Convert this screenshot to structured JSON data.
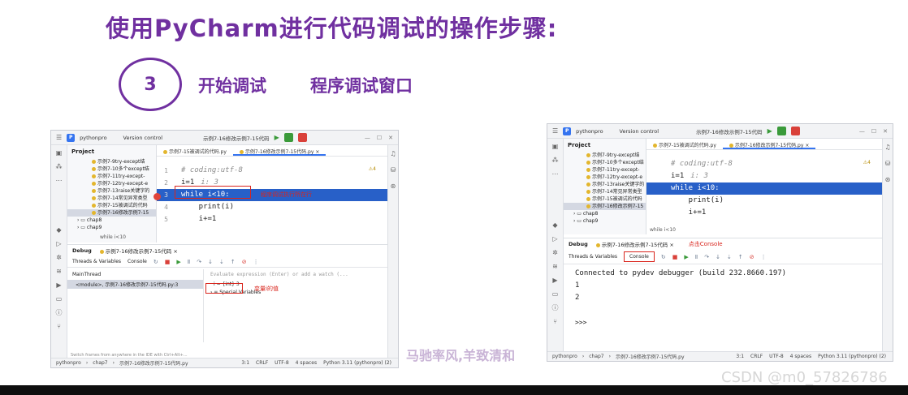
{
  "slide": {
    "title": "使用PyCharm进行代码调试的操作步骤:",
    "step_number": "3",
    "step_label": "开始调试",
    "step_label2": "程序调试窗口",
    "watermark": "马驰率风,羊致清和",
    "csdn": "CSDN @m0_57826786"
  },
  "left_ide": {
    "project_name": "pythonpro",
    "project_badge": "P",
    "version_control": "Version control",
    "run_config": "示例7-16修改示例7-15代码",
    "project_label": "Project",
    "tree": [
      "示例7-9try-except结",
      "示例7-10多个except结",
      "示例7-11try-except-",
      "示例7-12try-except-e",
      "示例7-13raise关键字的",
      "示例7-14常见异常类型",
      "示例7-15被调试的代码",
      "示例7-16修改示例7-15"
    ],
    "folders": [
      "chap8",
      "chap9"
    ],
    "tabs": [
      "示例7-15被调试的代码.py",
      "示例7-16修改示例7-15代码.py"
    ],
    "code": [
      {
        "n": "1",
        "text": "# coding:utf-8",
        "val": ""
      },
      {
        "n": "2",
        "text": "i=1",
        "val": "i: 3"
      },
      {
        "n": "3",
        "text": "while i<10:",
        "val": ""
      },
      {
        "n": "4",
        "text": "    print(i)",
        "val": ""
      },
      {
        "n": "5",
        "text": "    i+=1",
        "val": ""
      }
    ],
    "warn": "⚠4",
    "breadcrumb": "while i<10",
    "annotation_code": "程序调试执行所在行",
    "debug_title": "Debug",
    "debug_config": "示例7-16修改示例7-15代码",
    "debug_tabs": [
      "Threads & Variables",
      "Console"
    ],
    "thread": "MainThread",
    "frame": "<module>, 示例7-16修改示例7-15代码.py:3",
    "eval_placeholder": "Evaluate expression (Enter) or add a watch (...",
    "variable": "i = {int} 3",
    "special_vars": "Special Variables",
    "annotation_var": "变量i的值",
    "hint": "Switch frames from anywhere in the IDE with Ctrl+Alt+...",
    "status_path": [
      "pythonpro",
      "chap7",
      "示例7-16修改示例7-15代码.py"
    ],
    "status_right": [
      "3:1",
      "CRLF",
      "UTF-8",
      "4 spaces",
      "Python 3.11 (pythonpro) (2)"
    ]
  },
  "right_ide": {
    "project_name": "pythonpro",
    "project_badge": "P",
    "version_control": "Version control",
    "run_config": "示例7-16修改示例7-15代码",
    "project_label": "Project",
    "tree": [
      "示例7-9try-except结",
      "示例7-10多个except结",
      "示例7-11try-except-",
      "示例7-12try-except-e",
      "示例7-13raise关键字的",
      "示例7-14常见异常类型",
      "示例7-15被调试的代码",
      "示例7-16修改示例7-15"
    ],
    "folders": [
      "chap8",
      "chap9"
    ],
    "tabs": [
      "示例7-15被调试的代码.py",
      "示例7-16修改示例7-15代码.py"
    ],
    "code": [
      {
        "n": "1",
        "text": "# coding:utf-8",
        "val": ""
      },
      {
        "n": "2",
        "text": "i=1",
        "val": "i: 3"
      },
      {
        "n": "3",
        "text": "while i<10:",
        "val": ""
      },
      {
        "n": "4",
        "text": "    print(i)",
        "val": ""
      },
      {
        "n": "5",
        "text": "    i+=1",
        "val": ""
      }
    ],
    "warn": "⚠4",
    "breadcrumb": "while i<10",
    "debug_title": "Debug",
    "debug_config": "示例7-16修改示例7-15代码",
    "annotation_console": "点击Console",
    "debug_tabs": [
      "Threads & Variables",
      "Console"
    ],
    "console_lines": [
      "Connected to pydev debugger (build 232.8660.197)",
      "1",
      "2",
      "",
      ">>>"
    ],
    "status_path": [
      "pythonpro",
      "chap7",
      "示例7-16修改示例7-15代码.py"
    ],
    "status_right": [
      "3:1",
      "CRLF",
      "UTF-8",
      "4 spaces",
      "Python 3.11 (pythonpro) (2)"
    ]
  }
}
